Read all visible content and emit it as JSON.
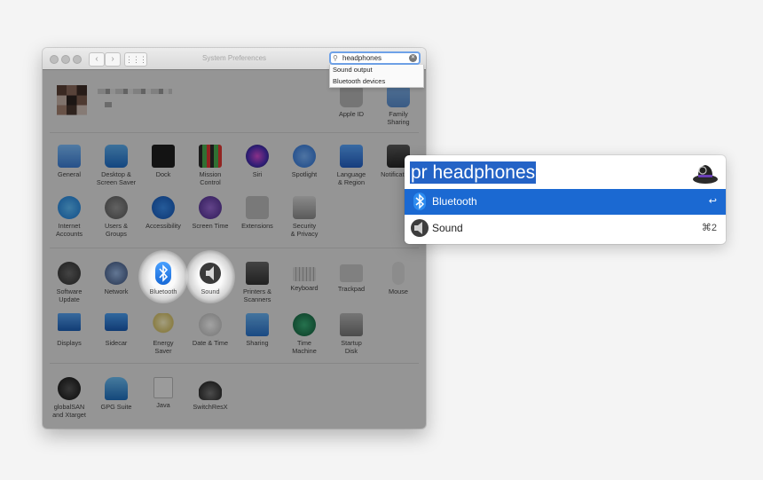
{
  "window": {
    "title": "System Preferences",
    "search": {
      "value": "headphones",
      "suggestions": [
        "Sound output",
        "Bluetooth devices"
      ]
    },
    "account_panes": [
      {
        "label": "Apple ID",
        "icon": "apple-id-icon"
      },
      {
        "label": "Family\nSharing",
        "icon": "family-sharing-icon"
      }
    ],
    "row1": [
      {
        "label": "General",
        "icon": "general-icon"
      },
      {
        "label": "Desktop &\nScreen Saver",
        "icon": "desktop-icon"
      },
      {
        "label": "Dock",
        "icon": "dock-icon"
      },
      {
        "label": "Mission\nControl",
        "icon": "mission-control-icon"
      },
      {
        "label": "Siri",
        "icon": "siri-icon"
      },
      {
        "label": "Spotlight",
        "icon": "spotlight-icon"
      },
      {
        "label": "Language\n& Region",
        "icon": "language-icon"
      },
      {
        "label": "Notifications",
        "icon": "notifications-icon"
      }
    ],
    "row2": [
      {
        "label": "Internet\nAccounts",
        "icon": "internet-accounts-icon"
      },
      {
        "label": "Users &\nGroups",
        "icon": "users-groups-icon"
      },
      {
        "label": "Accessibility",
        "icon": "accessibility-icon"
      },
      {
        "label": "Screen Time",
        "icon": "screen-time-icon"
      },
      {
        "label": "Extensions",
        "icon": "extensions-icon"
      },
      {
        "label": "Security\n& Privacy",
        "icon": "security-icon"
      }
    ],
    "row3": [
      {
        "label": "Software\nUpdate",
        "icon": "software-update-icon"
      },
      {
        "label": "Network",
        "icon": "network-icon"
      },
      {
        "label": "Bluetooth",
        "icon": "bluetooth-icon",
        "highlight": true
      },
      {
        "label": "Sound",
        "icon": "sound-icon",
        "highlight": true
      },
      {
        "label": "Printers &\nScanners",
        "icon": "printer-icon"
      },
      {
        "label": "Keyboard",
        "icon": "keyboard-icon"
      },
      {
        "label": "Trackpad",
        "icon": "trackpad-icon"
      },
      {
        "label": "Mouse",
        "icon": "mouse-icon"
      }
    ],
    "row4": [
      {
        "label": "Displays",
        "icon": "displays-icon"
      },
      {
        "label": "Sidecar",
        "icon": "sidecar-icon"
      },
      {
        "label": "Energy\nSaver",
        "icon": "energy-saver-icon"
      },
      {
        "label": "Date & Time",
        "icon": "date-time-icon"
      },
      {
        "label": "Sharing",
        "icon": "sharing-icon"
      },
      {
        "label": "Time\nMachine",
        "icon": "time-machine-icon"
      },
      {
        "label": "Startup\nDisk",
        "icon": "startup-disk-icon"
      }
    ],
    "row5": [
      {
        "label": "globalSAN\nand Xtarget",
        "icon": "globalsan-icon"
      },
      {
        "label": "GPG Suite",
        "icon": "gpg-suite-icon"
      },
      {
        "label": "Java",
        "icon": "java-icon"
      },
      {
        "label": "SwitchResX",
        "icon": "switchresx-icon"
      }
    ]
  },
  "alfred": {
    "query": "pr headphones",
    "results": [
      {
        "title": "Bluetooth",
        "hint": "↩",
        "icon": "bluetooth-icon"
      },
      {
        "title": "Sound",
        "hint": "⌘2",
        "icon": "speaker-icon"
      }
    ]
  },
  "colors": {
    "accent": "#1b69d2",
    "selection": "#2463c6",
    "bluetooth": "#2d8cf0"
  }
}
